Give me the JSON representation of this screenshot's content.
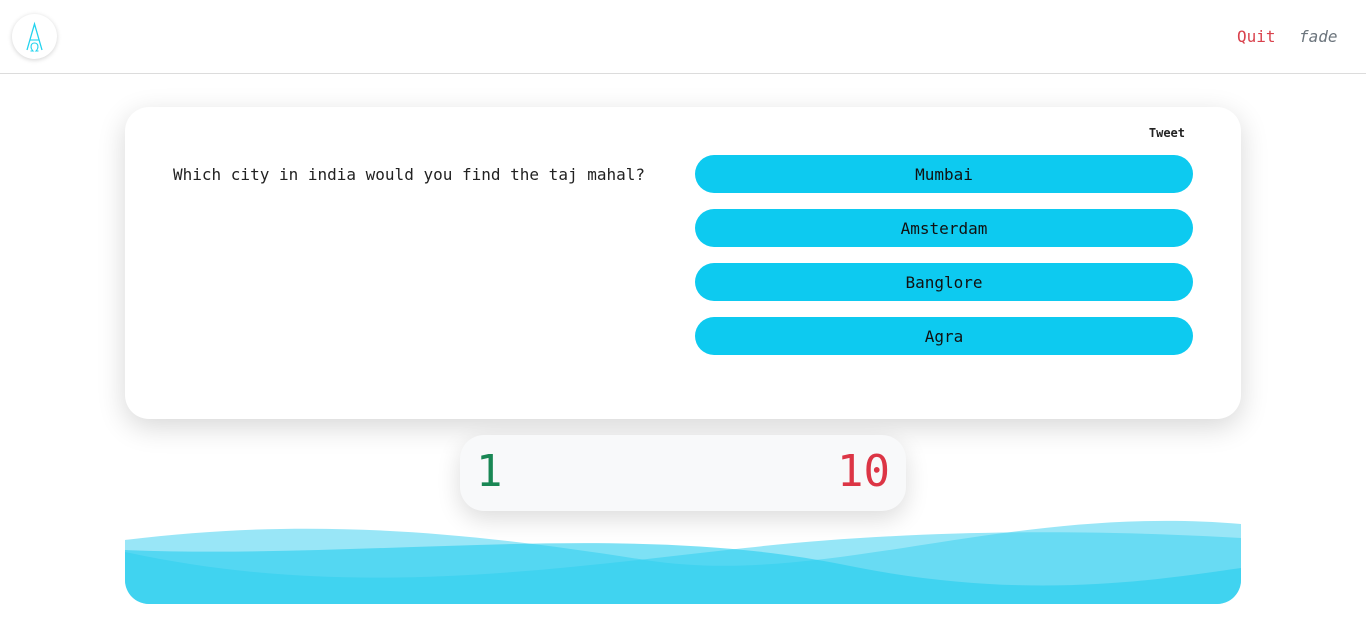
{
  "navbar": {
    "logo_icon": "logo-a-omega-icon",
    "quit_label": "Quit",
    "fade_label": "fade"
  },
  "quiz": {
    "tweet_label": "Tweet",
    "question": "Which city in india would you find the taj mahal?",
    "options": [
      "Mumbai",
      "Amsterdam",
      "Banglore",
      "Agra"
    ]
  },
  "score": {
    "current": "1",
    "total": "10",
    "current_color": "#198754",
    "total_color": "#dc3545"
  },
  "colors": {
    "option_bg": "#0dcaf0",
    "quit": "#d9414c",
    "wave": "#2fd0ef"
  }
}
